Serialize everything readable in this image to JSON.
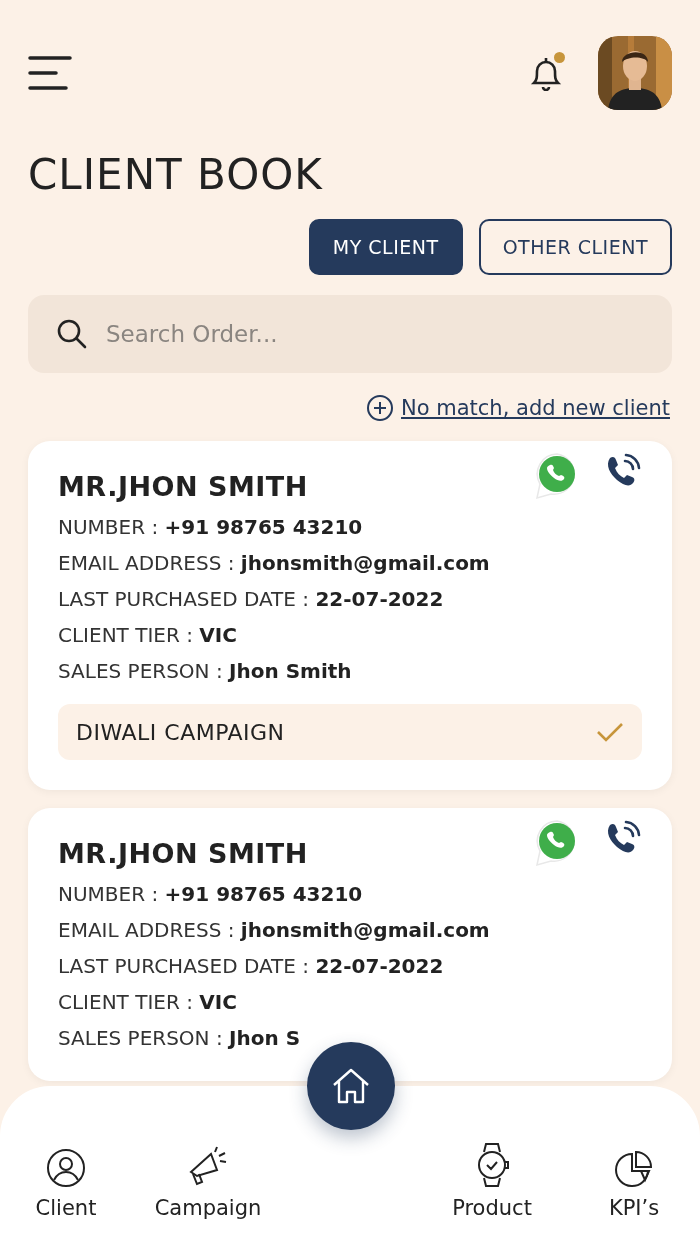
{
  "header": {
    "notification": true
  },
  "title": "CLIENT BOOK",
  "tabs": [
    {
      "label": "MY CLIENT",
      "selected": true
    },
    {
      "label": "OTHER CLIENT",
      "selected": false
    }
  ],
  "search": {
    "placeholder": "Search Order..."
  },
  "add_link": "No match, add new client",
  "clients": [
    {
      "name": "MR.JHON SMITH",
      "fields": [
        {
          "label": "NUMBER :",
          "value": "+91 98765 43210"
        },
        {
          "label": "EMAIL ADDRESS :",
          "value": "jhonsmith@gmail.com"
        },
        {
          "label": "LAST PURCHASED DATE :",
          "value": "22-07-2022"
        },
        {
          "label": "CLIENT TIER :",
          "value": "VIC"
        },
        {
          "label": "SALES PERSON :",
          "value": "Jhon Smith"
        }
      ],
      "campaign": {
        "label": "DIWALI CAMPAIGN",
        "checked": true
      }
    },
    {
      "name": "MR.JHON SMITH",
      "fields": [
        {
          "label": "NUMBER :",
          "value": "+91 98765 43210"
        },
        {
          "label": "EMAIL ADDRESS :",
          "value": "jhonsmith@gmail.com"
        },
        {
          "label": "LAST PURCHASED DATE :",
          "value": "22-07-2022"
        },
        {
          "label": "CLIENT TIER :",
          "value": "VIC"
        },
        {
          "label": "SALES PERSON :",
          "value": "Jhon S"
        }
      ]
    }
  ],
  "nav": [
    {
      "label": "Client"
    },
    {
      "label": "Campaign"
    },
    {
      "label": "Product"
    },
    {
      "label": "KPI’s"
    }
  ]
}
